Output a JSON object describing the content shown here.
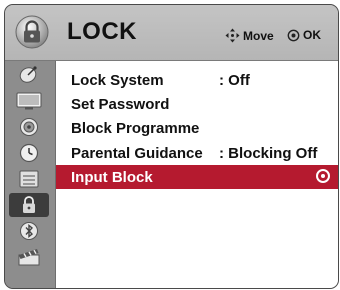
{
  "header": {
    "title": "LOCK",
    "icon": "padlock-icon",
    "move_hint": "Move",
    "ok_hint": "OK"
  },
  "sidebar": {
    "items": [
      {
        "icon": "satellite-dish-icon",
        "active": false
      },
      {
        "icon": "picture-icon",
        "active": false
      },
      {
        "icon": "audio-icon",
        "active": false
      },
      {
        "icon": "clock-icon",
        "active": false
      },
      {
        "icon": "option-icon",
        "active": false
      },
      {
        "icon": "lock-icon",
        "active": true
      },
      {
        "icon": "bluetooth-icon",
        "active": false
      },
      {
        "icon": "media-clapper-icon",
        "active": false
      }
    ]
  },
  "menu": {
    "items": [
      {
        "label": "Lock System",
        "value": ": Off"
      },
      {
        "label": "Set Password",
        "value": ""
      },
      {
        "label": "Block Programme",
        "value": ""
      },
      {
        "label": "Parental Guidance",
        "value": ": Blocking Off"
      },
      {
        "label": "Input Block",
        "value": "",
        "selected": true
      }
    ]
  },
  "colors": {
    "selection": "#b51a2f",
    "panel": "#9a9a9a",
    "header": "#c4c4c4"
  }
}
